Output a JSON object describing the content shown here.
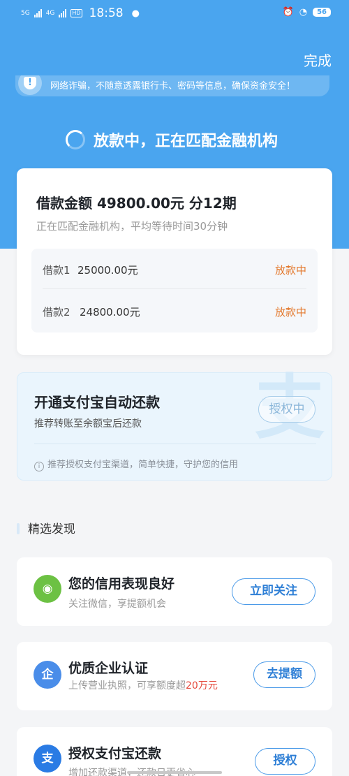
{
  "status_bar": {
    "net1": "5G",
    "net2": "4G",
    "hd": "HD",
    "time": "18:58",
    "battery": "56"
  },
  "header": {
    "done_label": "完成",
    "notice": "网络诈骗，不随意透露银行卡、密码等信息，确保资金安全！",
    "loading_text": "放款中，正在匹配金融机构"
  },
  "loan": {
    "title": "借款金额  49800.00元 分12期",
    "subtitle": "正在匹配金融机构，平均等待时间30分钟",
    "items": [
      {
        "label": "借款1",
        "amount": "25000.00元",
        "status": "放款中"
      },
      {
        "label": "借款2",
        "amount": "24800.00元",
        "status": "放款中"
      }
    ]
  },
  "alipay_auto": {
    "title": "开通支付宝自动还款",
    "subtitle": "推荐转账至余额宝后还款",
    "button": "授权中",
    "info": "推荐授权支付宝渠道，简单快捷，守护您的信用",
    "watermark": "支"
  },
  "discover": {
    "section_title": "精选发现",
    "items": [
      {
        "title": "您的信用表现良好",
        "subtitle": "关注微信，享提额机会",
        "button": "立即关注",
        "icon": "wechat-icon"
      },
      {
        "title": "优质企业认证",
        "subtitle_prefix": "上传营业执照，可享额度超",
        "subtitle_highlight": "20万元",
        "button": "去提额",
        "icon": "enterprise-icon"
      },
      {
        "title": "授权支付宝还款",
        "subtitle": "增加还款渠道，还款日更省心",
        "button": "授权",
        "icon": "alipay-icon"
      }
    ]
  },
  "colors": {
    "brand_blue": "#4aa5ef",
    "status_orange": "#e47a2f",
    "highlight_red": "#e5483b"
  }
}
